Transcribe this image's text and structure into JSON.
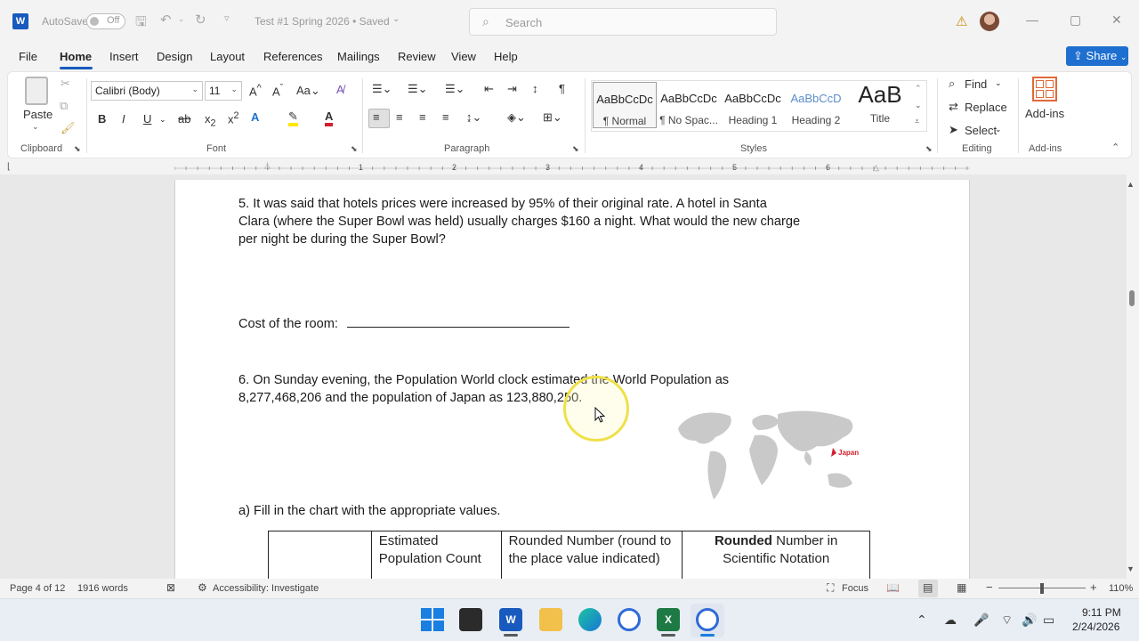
{
  "titlebar": {
    "autosave_label": "AutoSave",
    "autosave_state": "Off",
    "doc_title": "Test #1 Spring 2026 • Saved",
    "search_placeholder": "Search"
  },
  "menu_tabs": [
    "File",
    "Home",
    "Insert",
    "Design",
    "Layout",
    "References",
    "Mailings",
    "Review",
    "View",
    "Help"
  ],
  "share_label": "Share",
  "ribbon": {
    "clipboard": {
      "paste": "Paste",
      "group": "Clipboard"
    },
    "font": {
      "name": "Calibri (Body)",
      "size": "11",
      "group": "Font"
    },
    "paragraph": {
      "group": "Paragraph"
    },
    "styles": {
      "group": "Styles",
      "items": [
        {
          "preview": "AaBbCcDc",
          "name": "¶ Normal"
        },
        {
          "preview": "AaBbCcDc",
          "name": "¶ No Spac..."
        },
        {
          "preview": "AaBbCcDc",
          "name": "Heading 1"
        },
        {
          "preview": "AaBbCcD",
          "name": "Heading 2"
        },
        {
          "preview": "AaB",
          "name": "Title"
        }
      ]
    },
    "editing": {
      "find": "Find",
      "replace": "Replace",
      "select": "Select",
      "group": "Editing"
    },
    "addins": {
      "label": "Add-ins",
      "group": "Add-ins"
    }
  },
  "ruler": [
    "1",
    "2",
    "3",
    "4",
    "5",
    "6"
  ],
  "document": {
    "q5_line1": "5.  It was said that hotels prices were increased by 95% of their original rate.  A hotel in Santa",
    "q5_line2": "Clara (where the Super Bowl was held) usually charges $160 a night.  What would the new charge",
    "q5_line3": "per night be during the Super Bowl?",
    "cost_label": "Cost of the room:",
    "q6_line1": "6.  On Sunday evening, the Population World clock estimated the World Population as",
    "q6_line2": "8,277,468,206 and the population of Japan as 123,880,250.",
    "map_label": "Japan",
    "part_a": "a)  Fill in the chart with the appropriate values.",
    "table_headers": [
      "",
      "Estimated Population Count",
      "Rounded Number (round to the place value indicated)",
      "Number in Scientific Notation"
    ],
    "table_header4_bold": "Rounded"
  },
  "statusbar": {
    "page": "Page 4 of 12",
    "words": "1916 words",
    "accessibility": "Accessibility: Investigate",
    "focus": "Focus",
    "zoom": "110%"
  },
  "taskbar": {
    "time": "9:11 PM",
    "date": "2/24/2026"
  },
  "colors": {
    "word_blue": "#185abd",
    "share_blue": "#1e6fcf",
    "highlight_circle": "#f3e85a",
    "japan_red": "#d21f2b"
  }
}
